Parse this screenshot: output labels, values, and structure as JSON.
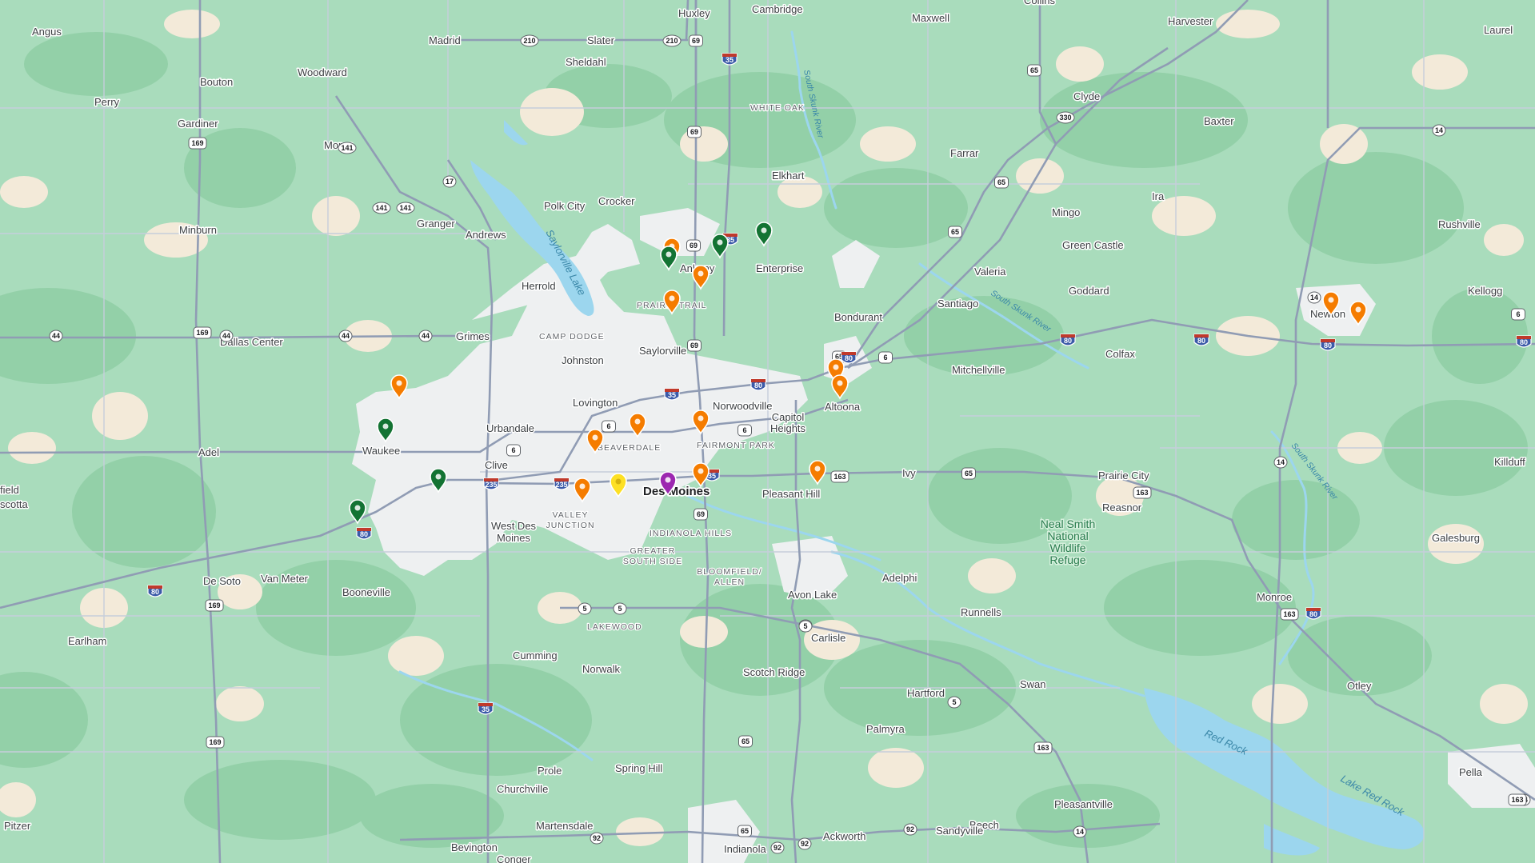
{
  "colors": {
    "land": "#a9dcbc",
    "forest": "#93d0a8",
    "farmland": "#f2e8d8",
    "urban": "#f1f3f4",
    "water": "#9cd6ee",
    "highway": "#8f9bb3",
    "road": "#b7c0cf",
    "pin_orange": "#f57c00",
    "pin_green": "#137333",
    "pin_yellow": "#fde024",
    "pin_purple": "#9c27b0"
  },
  "places": [
    {
      "name": "Angus"
    },
    {
      "name": "Huxley"
    },
    {
      "name": "Cambridge"
    },
    {
      "name": "Maxwell"
    },
    {
      "name": "Collins"
    },
    {
      "name": "Harvester"
    },
    {
      "name": "Laurel"
    },
    {
      "name": "Madrid"
    },
    {
      "name": "Slater"
    },
    {
      "name": "Sheldahl"
    },
    {
      "name": "Bouton"
    },
    {
      "name": "Woodward"
    },
    {
      "name": "Perry"
    },
    {
      "name": "Gardiner"
    },
    {
      "name": "Moran"
    },
    {
      "name": "Clyde"
    },
    {
      "name": "Baxter"
    },
    {
      "name": "Farrar"
    },
    {
      "name": "Elkhart"
    },
    {
      "name": "Minburn"
    },
    {
      "name": "Granger"
    },
    {
      "name": "Polk City"
    },
    {
      "name": "Crocker"
    },
    {
      "name": "Andrews"
    },
    {
      "name": "Mingo"
    },
    {
      "name": "Ira"
    },
    {
      "name": "Rushville"
    },
    {
      "name": "Green Castle"
    },
    {
      "name": "Ankeny"
    },
    {
      "name": "Enterprise"
    },
    {
      "name": "Valeria"
    },
    {
      "name": "Goddard"
    },
    {
      "name": "Kellogg"
    },
    {
      "name": "Herrold"
    },
    {
      "name": "Santiago"
    },
    {
      "name": "Newton"
    },
    {
      "name": "Bondurant"
    },
    {
      "name": "Dallas Center"
    },
    {
      "name": "Grimes"
    },
    {
      "name": "Saylorville"
    },
    {
      "name": "Colfax"
    },
    {
      "name": "Johnston"
    },
    {
      "name": "Mitchellville"
    },
    {
      "name": "Altoona"
    },
    {
      "name": "Lovington"
    },
    {
      "name": "Norwoodville"
    },
    {
      "name": "Capitol Heights"
    },
    {
      "name": "Urbandale"
    },
    {
      "name": "Adel"
    },
    {
      "name": "Waukee"
    },
    {
      "name": "Killduff"
    },
    {
      "name": "Clive"
    },
    {
      "name": "Ivy"
    },
    {
      "name": "Prairie City"
    },
    {
      "name": "Des Moines"
    },
    {
      "name": "Pleasant Hill"
    },
    {
      "name": "West Des Moines"
    },
    {
      "name": "Reasnor"
    },
    {
      "name": "Neal Smith National Wildlife Refuge"
    },
    {
      "name": "Galesburg"
    },
    {
      "name": "De Soto"
    },
    {
      "name": "Van Meter"
    },
    {
      "name": "Booneville"
    },
    {
      "name": "Adelphi"
    },
    {
      "name": "Avon Lake"
    },
    {
      "name": "Monroe"
    },
    {
      "name": "Runnells"
    },
    {
      "name": "Earlham"
    },
    {
      "name": "Carlisle"
    },
    {
      "name": "Cumming"
    },
    {
      "name": "Norwalk"
    },
    {
      "name": "Scotch Ridge"
    },
    {
      "name": "Swan"
    },
    {
      "name": "Otley"
    },
    {
      "name": "Hartford"
    },
    {
      "name": "Palmyra"
    },
    {
      "name": "Prole"
    },
    {
      "name": "Spring Hill"
    },
    {
      "name": "Pella"
    },
    {
      "name": "Churchville"
    },
    {
      "name": "Pleasantville"
    },
    {
      "name": "Pitzer"
    },
    {
      "name": "Martensdale"
    },
    {
      "name": "Beech"
    },
    {
      "name": "Ackworth"
    },
    {
      "name": "Sandyville"
    },
    {
      "name": "Bevington"
    },
    {
      "name": "Indianola"
    },
    {
      "name": "Conger"
    },
    {
      "name": "field"
    },
    {
      "name": "scotta"
    }
  ],
  "neighborhoods": [
    {
      "name": "WHITE OAK"
    },
    {
      "name": "PRAIRIE TRAIL"
    },
    {
      "name": "CAMP DODGE"
    },
    {
      "name": "BEAVERDALE"
    },
    {
      "name": "FAIRMONT PARK"
    },
    {
      "name": "VALLEY JUNCTION"
    },
    {
      "name": "INDIANOLA HILLS"
    },
    {
      "name": "GREATER SOUTH SIDE"
    },
    {
      "name": "BLOOMFIELD/ ALLEN"
    },
    {
      "name": "LAKEWOOD"
    }
  ],
  "water_labels": [
    {
      "name": "Saylorville Lake"
    },
    {
      "name": "South Skunk River"
    },
    {
      "name": "Red Rock"
    },
    {
      "name": "Lake Red Rock"
    }
  ],
  "shields": [
    {
      "num": "210"
    },
    {
      "num": "210"
    },
    {
      "num": "69"
    },
    {
      "num": "35"
    },
    {
      "num": "169"
    },
    {
      "num": "141"
    },
    {
      "num": "141"
    },
    {
      "num": "141"
    },
    {
      "num": "17"
    },
    {
      "num": "69"
    },
    {
      "num": "65"
    },
    {
      "num": "330"
    },
    {
      "num": "14"
    },
    {
      "num": "65"
    },
    {
      "num": "65"
    },
    {
      "num": "69"
    },
    {
      "num": "35"
    },
    {
      "num": "44"
    },
    {
      "num": "44"
    },
    {
      "num": "44"
    },
    {
      "num": "44"
    },
    {
      "num": "169"
    },
    {
      "num": "69"
    },
    {
      "num": "65"
    },
    {
      "num": "80"
    },
    {
      "num": "80"
    },
    {
      "num": "80"
    },
    {
      "num": "80"
    },
    {
      "num": "80"
    },
    {
      "num": "6"
    },
    {
      "num": "14"
    },
    {
      "num": "35"
    },
    {
      "num": "6"
    },
    {
      "num": "6"
    },
    {
      "num": "6"
    },
    {
      "num": "6"
    },
    {
      "num": "80"
    },
    {
      "num": "235"
    },
    {
      "num": "235"
    },
    {
      "num": "35"
    },
    {
      "num": "69"
    },
    {
      "num": "163"
    },
    {
      "num": "65"
    },
    {
      "num": "163"
    },
    {
      "num": "163"
    },
    {
      "num": "14"
    },
    {
      "num": "80"
    },
    {
      "num": "80"
    },
    {
      "num": "80"
    },
    {
      "num": "169"
    },
    {
      "num": "5"
    },
    {
      "num": "5"
    },
    {
      "num": "5"
    },
    {
      "num": "163"
    },
    {
      "num": "14"
    },
    {
      "num": "35"
    },
    {
      "num": "169"
    },
    {
      "num": "65"
    },
    {
      "num": "5"
    },
    {
      "num": "5"
    },
    {
      "num": "14"
    },
    {
      "num": "163"
    },
    {
      "num": "92"
    },
    {
      "num": "65"
    },
    {
      "num": "92"
    },
    {
      "num": "92"
    },
    {
      "num": "92"
    }
  ],
  "markers": [
    {
      "color": "orange"
    },
    {
      "color": "orange"
    },
    {
      "color": "orange"
    },
    {
      "color": "orange"
    },
    {
      "color": "orange"
    },
    {
      "color": "orange"
    },
    {
      "color": "orange"
    },
    {
      "color": "orange"
    },
    {
      "color": "orange"
    },
    {
      "color": "orange"
    },
    {
      "color": "orange"
    },
    {
      "color": "orange"
    },
    {
      "color": "orange"
    },
    {
      "color": "orange"
    },
    {
      "color": "orange"
    },
    {
      "color": "green"
    },
    {
      "color": "green"
    },
    {
      "color": "green"
    },
    {
      "color": "green"
    },
    {
      "color": "green"
    },
    {
      "color": "green"
    },
    {
      "color": "green"
    },
    {
      "color": "yellow"
    },
    {
      "color": "purple"
    }
  ]
}
